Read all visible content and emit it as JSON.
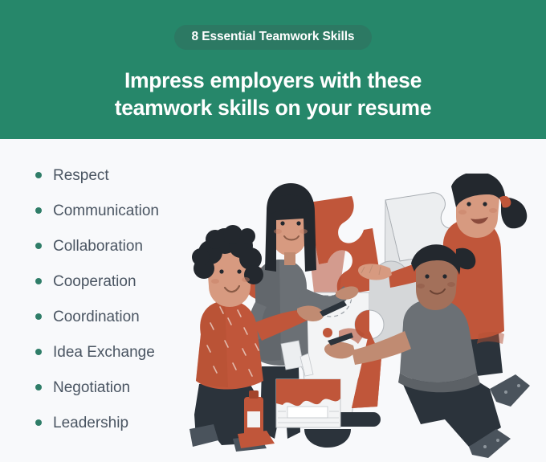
{
  "header": {
    "badge_label": "8 Essential Teamwork Skills",
    "headline_line1": "Impress employers with these",
    "headline_line2": "teamwork skills on your resume",
    "background_color": "#26876a",
    "badge_color": "#2c7963",
    "text_color": "#ffffff"
  },
  "body": {
    "background_color": "#f8f9fb",
    "bullet_color": "#2f7d68",
    "text_color": "#4a5562"
  },
  "skills": [
    {
      "label": "Respect"
    },
    {
      "label": "Communication"
    },
    {
      "label": "Collaboration"
    },
    {
      "label": "Cooperation"
    },
    {
      "label": "Coordination"
    },
    {
      "label": "Idea Exchange"
    },
    {
      "label": "Negotiation"
    },
    {
      "label": "Leadership"
    }
  ],
  "illustration": {
    "name": "teamwork-puzzle-illustration",
    "description": "Four people assembling a large jigsaw puzzle together",
    "palette": {
      "orange": "#c0563a",
      "orange_light": "#c75f42",
      "gray_shirt": "#6b7075",
      "dark_navy": "#2b333b",
      "puzzle_light": "#eceef0",
      "puzzle_gray": "#d5d7d9",
      "skin_light": "#e8a68d",
      "skin_mid": "#c08b72",
      "skin_dark": "#a3705a",
      "hair_black": "#23282e",
      "outline": "#9aa0a6"
    },
    "figures": [
      {
        "name": "woman-standing-orange-piece",
        "hair": "long black",
        "top": "gray sweater"
      },
      {
        "name": "child-curly-hair",
        "top": "orange patterned sweater"
      },
      {
        "name": "woman-ponytail-right",
        "top": "orange sweater"
      },
      {
        "name": "man-kneeling-right",
        "top": "gray t-shirt"
      }
    ],
    "props": [
      "paint-bucket",
      "paint-brushes",
      "notepad",
      "paint-tube"
    ]
  }
}
